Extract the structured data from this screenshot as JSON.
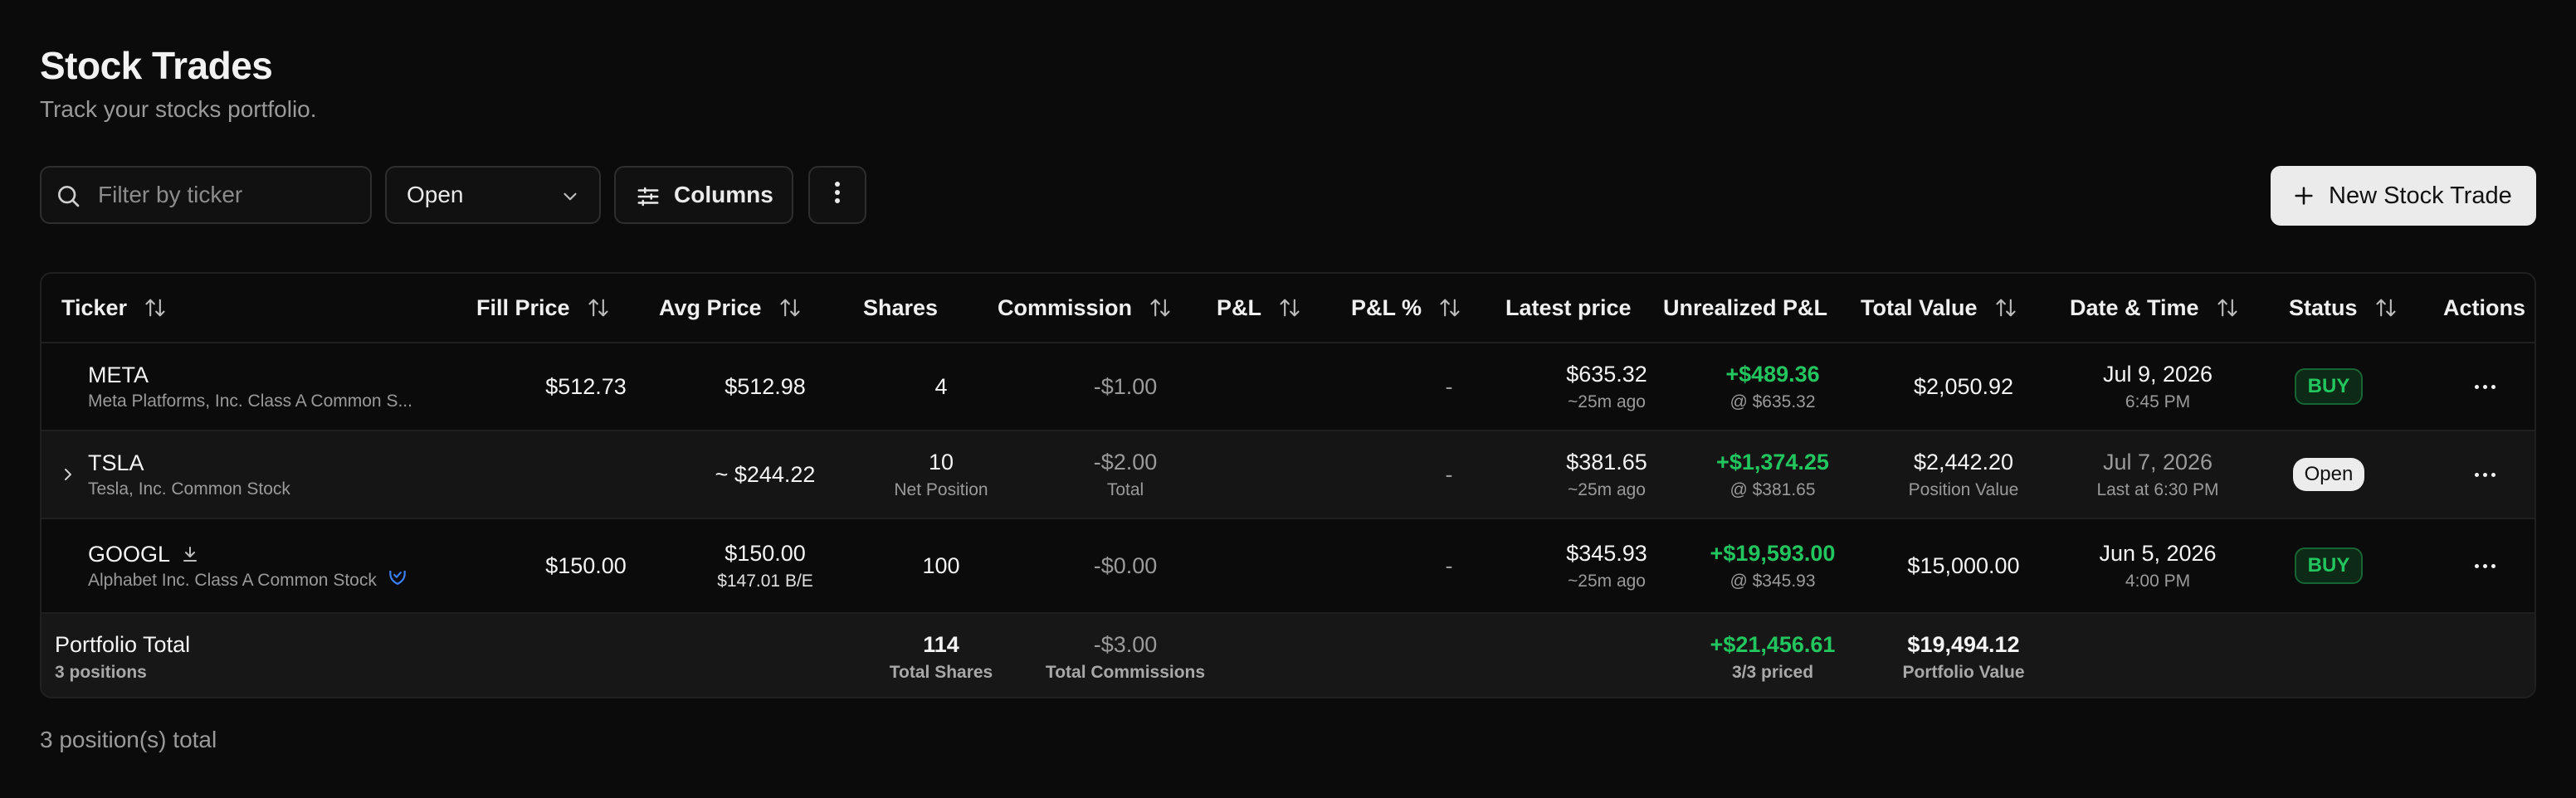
{
  "page": {
    "title": "Stock Trades",
    "subtitle": "Track your stocks portfolio."
  },
  "toolbar": {
    "search_placeholder": "Filter by ticker",
    "status_value": "Open",
    "columns_label": "Columns",
    "new_trade_label": "New Stock Trade"
  },
  "table": {
    "headers": {
      "ticker": "Ticker",
      "fill_price": "Fill Price",
      "avg_price": "Avg Price",
      "shares": "Shares",
      "commission": "Commission",
      "pnl": "P&L",
      "pnl_pct": "P&L %",
      "latest_price": "Latest price",
      "unrealized": "Unrealized P&L",
      "total_value": "Total Value",
      "datetime": "Date & Time",
      "status": "Status",
      "actions": "Actions"
    },
    "rows": [
      {
        "ticker": "META",
        "name": "Meta Platforms, Inc. Class A Common S...",
        "fill_price": "$512.73",
        "avg_price": "$512.98",
        "shares": "4",
        "commission": "-$1.00",
        "pnl_pct": "-",
        "latest": "$635.32",
        "latest_sub": "~25m ago",
        "unrealized": "+$489.36",
        "unrealized_sub": "@ $635.32",
        "total_value": "$2,050.92",
        "date": "Jul 9, 2026",
        "time": "6:45 PM",
        "status": "BUY"
      },
      {
        "ticker": "TSLA",
        "name": "Tesla, Inc. Common Stock",
        "avg_price": "~ $244.22",
        "shares": "10",
        "shares_sub": "Net Position",
        "commission": "-$2.00",
        "commission_sub": "Total",
        "pnl_pct": "-",
        "latest": "$381.65",
        "latest_sub": "~25m ago",
        "unrealized": "+$1,374.25",
        "unrealized_sub": "@ $381.65",
        "total_value": "$2,442.20",
        "total_value_sub": "Position Value",
        "date": "Jul 7, 2026",
        "time": "Last at 6:30 PM",
        "status": "Open"
      },
      {
        "ticker": "GOOGL",
        "name": "Alphabet Inc. Class A Common Stock",
        "fill_price": "$150.00",
        "avg_price": "$150.00",
        "avg_sub": "$147.01 B/E",
        "shares": "100",
        "commission": "-$0.00",
        "pnl_pct": "-",
        "latest": "$345.93",
        "latest_sub": "~25m ago",
        "unrealized": "+$19,593.00",
        "unrealized_sub": "@ $345.93",
        "total_value": "$15,000.00",
        "date": "Jun 5, 2026",
        "time": "4:00 PM",
        "status": "BUY"
      }
    ],
    "footer": {
      "label": "Portfolio Total",
      "positions": "3 positions",
      "shares": "114",
      "shares_sub": "Total Shares",
      "commission": "-$3.00",
      "commission_sub": "Total Commissions",
      "unrealized": "+$21,456.61",
      "unrealized_sub": "3/3 priced",
      "total_value": "$19,494.12",
      "total_value_sub": "Portfolio Value"
    }
  },
  "summary": "3 position(s) total",
  "colors": {
    "background": "#0b0b0b",
    "positive": "#22c55e",
    "verified_badge": "#3b82f6"
  }
}
